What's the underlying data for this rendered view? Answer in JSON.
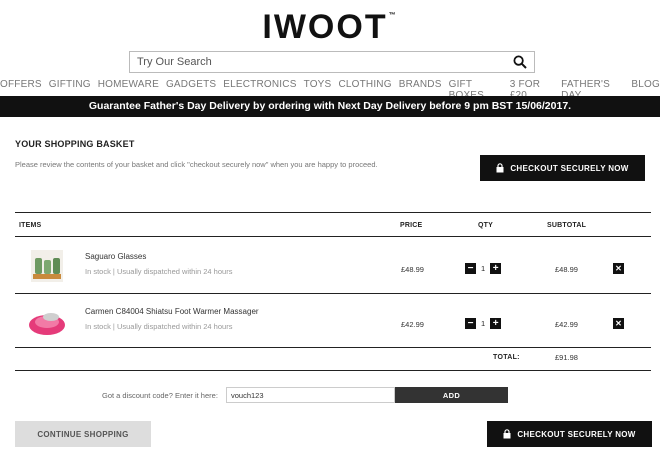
{
  "header": {
    "logo": "IWOOT",
    "logo_mark": "™",
    "search": {
      "placeholder": "Try Our Search",
      "value": ""
    },
    "nav": [
      "OFFERS",
      "GIFTING",
      "HOMEWARE",
      "GADGETS",
      "ELECTRONICS",
      "TOYS",
      "CLOTHING",
      "BRANDS",
      "GIFT BOXES",
      "3 FOR £20",
      "FATHER'S DAY",
      "BLOG"
    ]
  },
  "promo_banner": "Guarantee Father's Day Delivery by ordering with Next Day Delivery before 9 pm BST 15/06/2017.",
  "basket": {
    "title": "YOUR SHOPPING BASKET",
    "description": "Please review the contents of your basket and click \"checkout securely now\" when you are happy to proceed.",
    "checkout_label": "CHECKOUT SECURELY NOW",
    "columns": {
      "items": "ITEMS",
      "price": "PRICE",
      "qty": "QTY",
      "subtotal": "SUBTOTAL"
    },
    "items": [
      {
        "name": "Saguaro Glasses",
        "stock": "In stock | Usually dispatched within 24 hours",
        "price": "£48.99",
        "qty": "1",
        "subtotal": "£48.99",
        "thumb_icon": "glasses-product-image"
      },
      {
        "name": "Carmen C84004 Shiatsu Foot Warmer Massager",
        "stock": "In stock | Usually dispatched within 24 hours",
        "price": "£42.99",
        "qty": "1",
        "subtotal": "£42.99",
        "thumb_icon": "foot-massager-product-image"
      }
    ],
    "total_label": "TOTAL:",
    "total_value": "£91.98"
  },
  "discount": {
    "label": "Got a discount code? Enter it here:",
    "value": "vouch123",
    "button": "ADD"
  },
  "footer": {
    "continue_label": "CONTINUE SHOPPING",
    "checkout_label": "CHECKOUT SECURELY NOW"
  },
  "colors": {
    "primary": "#111111",
    "secondary_button": "#dddddd",
    "muted_text": "#999999"
  }
}
